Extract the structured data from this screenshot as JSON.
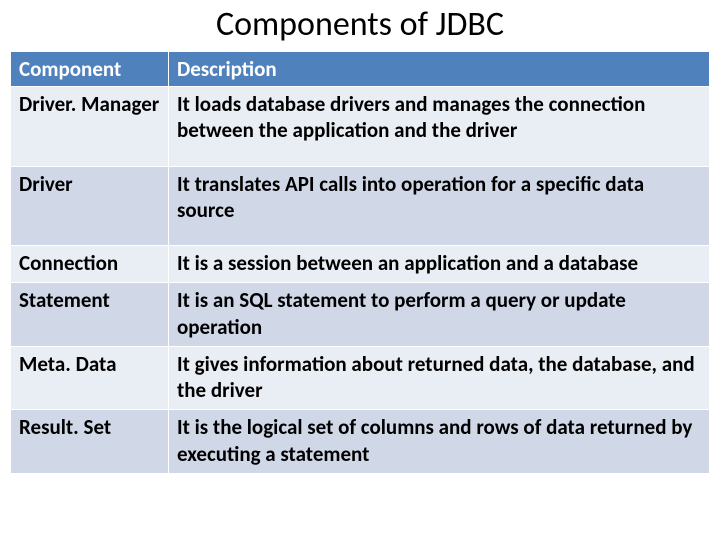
{
  "title": "Components of JDBC",
  "headers": {
    "c1": "Component",
    "c2": "Description"
  },
  "rows": [
    {
      "c1": "Driver. Manager",
      "c2": "It loads database drivers and manages the connection between the application and the driver"
    },
    {
      "c1": "Driver",
      "c2": "It translates API calls into operation for a specific data source"
    },
    {
      "c1": "Connection",
      "c2": "It is a session between an application and a database"
    },
    {
      "c1": "Statement",
      "c2": "It is an SQL statement to perform a query or update operation"
    },
    {
      "c1": "Meta. Data",
      "c2": "It gives information about returned data, the database, and the driver"
    },
    {
      "c1": "Result. Set",
      "c2": "It is the logical set of columns and rows of data returned by executing a statement"
    }
  ]
}
